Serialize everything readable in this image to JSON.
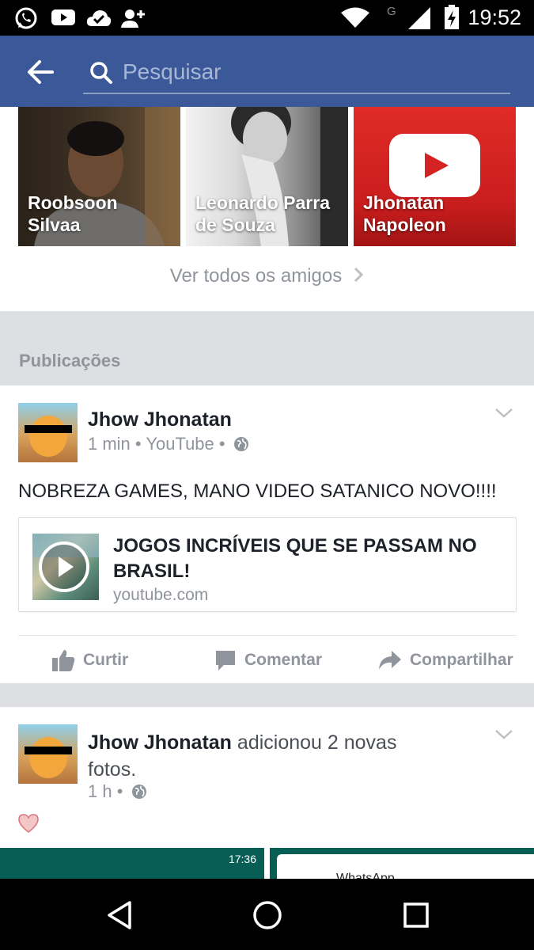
{
  "status_bar": {
    "time": "19:52",
    "icons": [
      "whatsapp-icon",
      "youtube-icon",
      "cloud-check-icon",
      "add-person-icon",
      "wifi-icon",
      "signal-icon",
      "battery-charging-icon"
    ]
  },
  "search": {
    "placeholder": "Pesquisar"
  },
  "friends": {
    "tiles": [
      {
        "name": "Roobsoon Silvaa"
      },
      {
        "name": "Leonardo Parra de Souza"
      },
      {
        "name": "Jhonatan Napoleon"
      }
    ],
    "see_all_label": "Ver todos os amigos"
  },
  "section": {
    "title": "Publicações"
  },
  "posts": [
    {
      "author": "Jhow Jhonatan",
      "meta": "1 min • YouTube •",
      "text": "NOBREZA GAMES, MANO VIDEO SATANICO NOVO!!!!",
      "link": {
        "title": "JOGOS INCRÍVEIS QUE SE PASSAM NO BRASIL!",
        "domain": "youtube.com"
      },
      "actions": {
        "like": "Curtir",
        "comment": "Comentar",
        "share": "Compartilhar"
      }
    },
    {
      "author": "Jhow Jhonatan",
      "action_text": "adicionou 2 novas fotos.",
      "meta": "1 h •",
      "photos": [
        {
          "time": "17:36"
        },
        {
          "label": "WhatsApp"
        }
      ]
    }
  ],
  "colors": {
    "facebook_blue": "#3b5998",
    "muted_text": "#90949c",
    "section_gray": "#dddfe2"
  }
}
